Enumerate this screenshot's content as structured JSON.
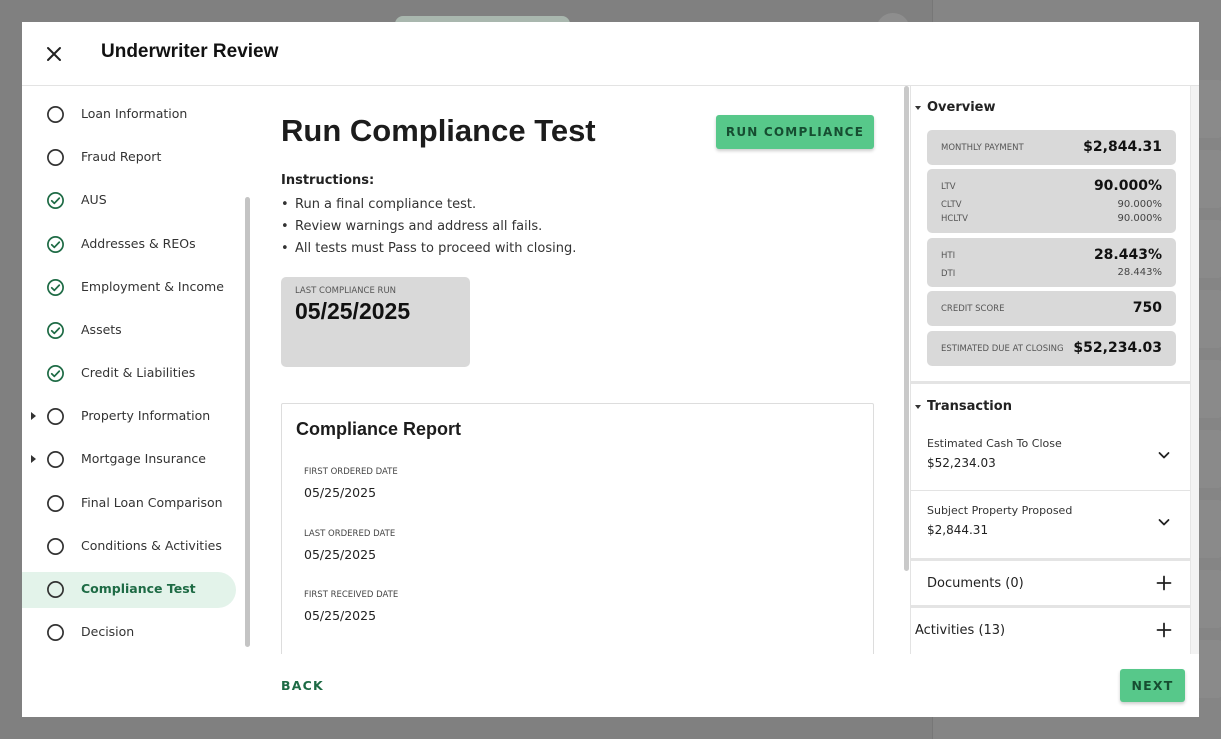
{
  "modal": {
    "title": "Underwriter Review"
  },
  "nav": {
    "items": [
      {
        "label": "Loan Information",
        "status": "empty"
      },
      {
        "label": "Fraud Report",
        "status": "empty"
      },
      {
        "label": "AUS",
        "status": "complete"
      },
      {
        "label": "Addresses & REOs",
        "status": "complete"
      },
      {
        "label": "Employment & Income",
        "status": "complete"
      },
      {
        "label": "Assets",
        "status": "complete"
      },
      {
        "label": "Credit & Liabilities",
        "status": "complete"
      },
      {
        "label": "Property Information",
        "status": "empty",
        "expandable": true
      },
      {
        "label": "Mortgage Insurance",
        "status": "empty",
        "expandable": true
      },
      {
        "label": "Final Loan Comparison",
        "status": "empty"
      },
      {
        "label": "Conditions & Activities",
        "status": "empty"
      },
      {
        "label": "Compliance Test",
        "status": "empty",
        "active": true
      },
      {
        "label": "Decision",
        "status": "empty"
      }
    ]
  },
  "main": {
    "title": "Run Compliance Test",
    "run_button": "RUN COMPLIANCE",
    "instructions_heading": "Instructions:",
    "instructions": [
      "Run a final compliance test.",
      "Review warnings and address all fails.",
      "All tests must Pass to proceed with closing."
    ],
    "last_run": {
      "label": "LAST COMPLIANCE RUN",
      "date": "05/25/2025"
    },
    "report": {
      "title": "Compliance Report",
      "fields": [
        {
          "label": "FIRST ORDERED DATE",
          "value": "05/25/2025"
        },
        {
          "label": "LAST ORDERED DATE",
          "value": "05/25/2025"
        },
        {
          "label": "FIRST RECEIVED DATE",
          "value": "05/25/2025"
        }
      ]
    }
  },
  "footer": {
    "back": "BACK",
    "next": "NEXT"
  },
  "overview": {
    "heading": "Overview",
    "monthly_payment": {
      "label": "MONTHLY PAYMENT",
      "value": "$2,844.31"
    },
    "ltv": {
      "label": "LTV",
      "value": "90.000%"
    },
    "cltv": {
      "label": "CLTV",
      "value": "90.000%"
    },
    "hcltv": {
      "label": "HCLTV",
      "value": "90.000%"
    },
    "hti": {
      "label": "HTI",
      "value": "28.443%"
    },
    "dti": {
      "label": "DTI",
      "value": "28.443%"
    },
    "credit_score": {
      "label": "CREDIT SCORE",
      "value": "750"
    },
    "due_at_closing": {
      "label": "ESTIMATED DUE AT CLOSING",
      "value": "$52,234.03"
    }
  },
  "transaction": {
    "heading": "Transaction",
    "rows": [
      {
        "label": "Estimated Cash To Close",
        "value": "$52,234.03"
      },
      {
        "label": "Subject Property Proposed",
        "value": "$2,844.31"
      }
    ]
  },
  "documents": {
    "label": "Documents (0)"
  },
  "activities": {
    "label": "Activities (13)"
  },
  "colors": {
    "accent": "#57c88a",
    "accent_text": "#1e6b45",
    "active_nav_bg": "#e3f3ea",
    "card_bg": "#d9d9d9"
  }
}
